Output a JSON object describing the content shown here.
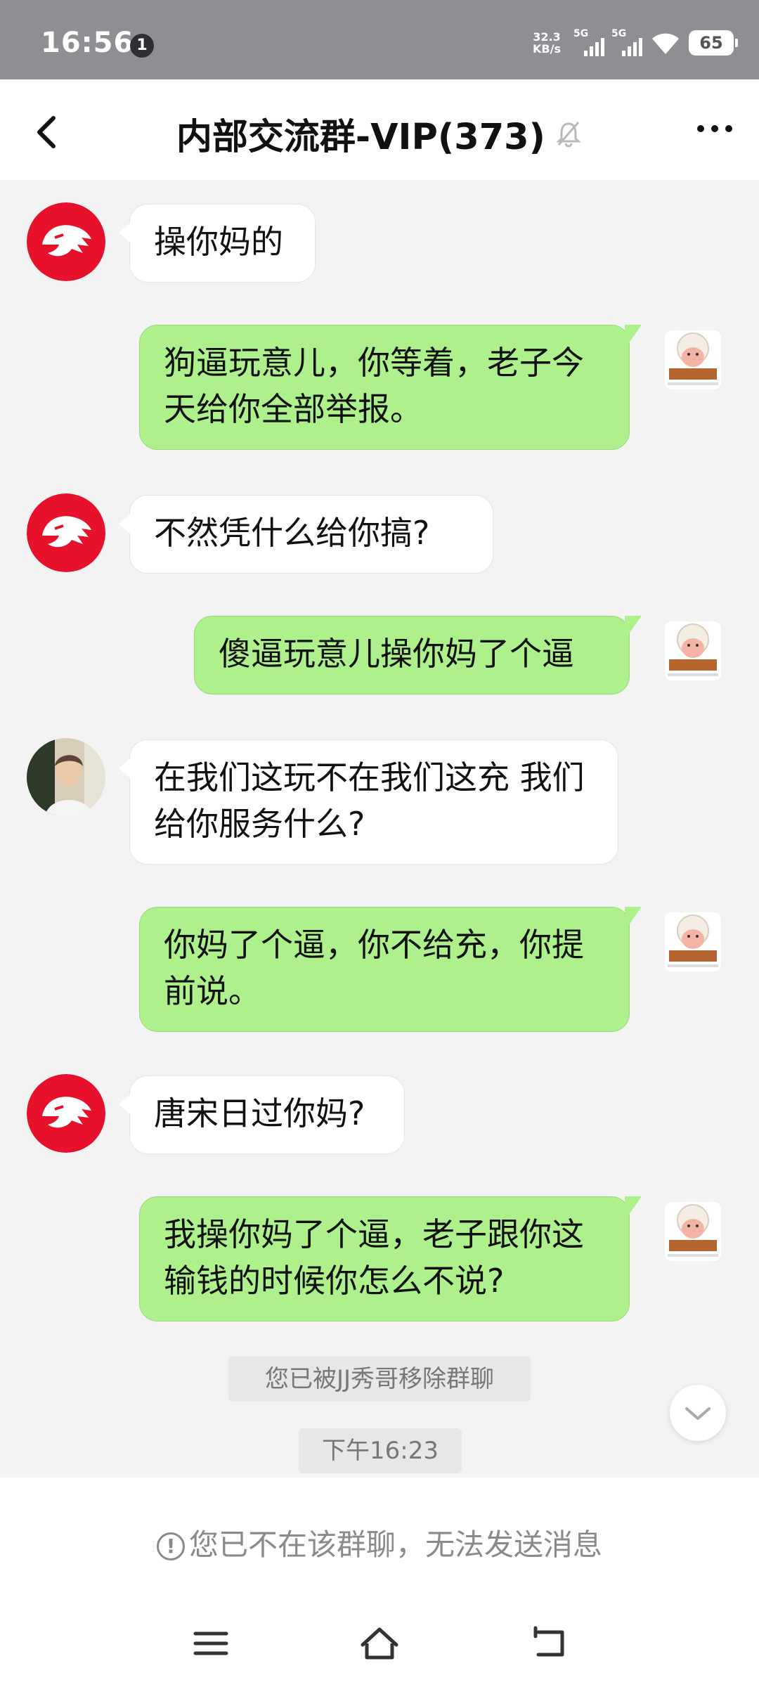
{
  "status_bar": {
    "time": "16:56",
    "notification_count": "1",
    "net_speed_value": "32.3",
    "net_speed_unit": "KB/s",
    "sim1_label": "5G",
    "sim2_label": "5G",
    "battery_level": "65"
  },
  "header": {
    "title": "内部交流群-VIP(373)",
    "back_icon": "chevron-left-icon",
    "mute_icon": "bell-off-icon",
    "more_icon": "more-dots-icon"
  },
  "messages": [
    {
      "side": "in",
      "text": "操你妈的",
      "avatar": "red-tiger-logo"
    },
    {
      "side": "out",
      "text": "狗逼玩意儿，你等着，老子今天给你全部举报。",
      "avatar": "sheep-avatar"
    },
    {
      "side": "in",
      "text": "不然凭什么给你搞?",
      "avatar": "red-tiger-logo"
    },
    {
      "side": "out",
      "text": "傻逼玩意儿操你妈了个逼",
      "avatar": "sheep-avatar"
    },
    {
      "side": "in",
      "text": "在我们这玩不在我们这充 我们给你服务什么?",
      "avatar": "person-photo"
    },
    {
      "side": "out",
      "text": "你妈了个逼，你不给充，你提前说。",
      "avatar": "sheep-avatar"
    },
    {
      "side": "in",
      "text": "唐宋日过你妈?",
      "avatar": "red-tiger-logo"
    },
    {
      "side": "out",
      "text": "我操你妈了个逼，老子跟你这输钱的时候你怎么不说?",
      "avatar": "sheep-avatar"
    }
  ],
  "system": {
    "removed_notice": "您已被JJ秀哥移除群聊",
    "timestamp": "下午16:23"
  },
  "footer": {
    "notice_icon": "!",
    "notice_text": "您已不在该群聊，无法发送消息"
  },
  "nav_bar": {
    "menu_icon": "menu-icon",
    "home_icon": "home-icon",
    "back_icon": "back-icon"
  }
}
